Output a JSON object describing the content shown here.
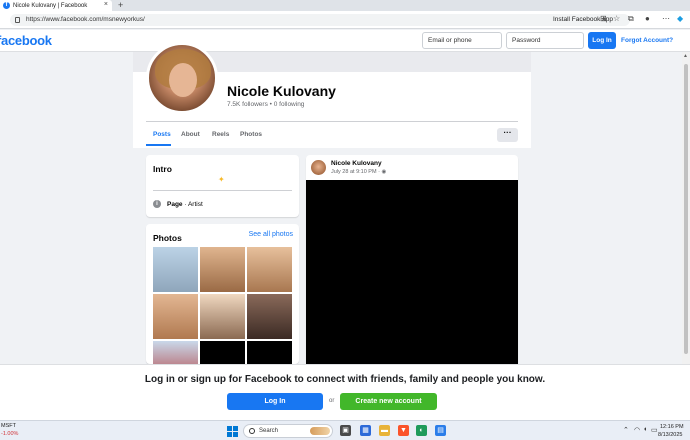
{
  "browser": {
    "tab_title": "Nicole Kulovany | Facebook",
    "tab_close": "×",
    "new_tab": "+",
    "url": "https://www.facebook.com/msnewyorkus/",
    "install_app": "Install Facebook app"
  },
  "header": {
    "logo": "facebook",
    "email_placeholder": "Email or phone",
    "password_placeholder": "Password",
    "login_label": "Log In",
    "forgot_label": "Forgot Account?"
  },
  "profile": {
    "name": "Nicole Kulovany",
    "stats": "7.5K followers • 0 following",
    "tabs": [
      "Posts",
      "About",
      "Reels",
      "Photos"
    ],
    "more_label": "···"
  },
  "intro": {
    "title": "Intro",
    "category_label": "Page",
    "category_value": " · Artist"
  },
  "photos": {
    "title": "Photos",
    "see_all": "See all photos",
    "tiles": [
      {
        "color_top": "#bcd3e6",
        "color_bottom": "#8fa6bb"
      },
      {
        "color_top": "#e0b58f",
        "color_bottom": "#9a6a45"
      },
      {
        "color_top": "#e7c09c",
        "color_bottom": "#a87750"
      },
      {
        "color_top": "#e3b793",
        "color_bottom": "#b07950"
      },
      {
        "color_top": "#f0d8c0",
        "color_bottom": "#8b6a52"
      },
      {
        "color_top": "#8a6a5a",
        "color_bottom": "#3b2a24"
      },
      {
        "color_top": "#c9d8ea",
        "color_bottom": "#b03a3a"
      },
      {
        "color_top": "#000000",
        "color_bottom": "#000000"
      },
      {
        "color_top": "#000000",
        "color_bottom": "#000000"
      }
    ]
  },
  "post": {
    "author": "Nicole Kulovany",
    "meta": "July 28 at 9:10 PM · ◉"
  },
  "banner": {
    "text": "Log in or sign up for Facebook to connect with friends, family and people you know.",
    "login_label": "Log In",
    "or_label": "or",
    "create_label": "Create new account"
  },
  "taskbar": {
    "ticker_name": "MSFT",
    "ticker_change": "-1.00%",
    "search_label": "Search",
    "time": "12:16 PM",
    "date": "8/13/2025"
  },
  "colors": {
    "brand": "#1877f2",
    "create_green": "#42b72a"
  }
}
